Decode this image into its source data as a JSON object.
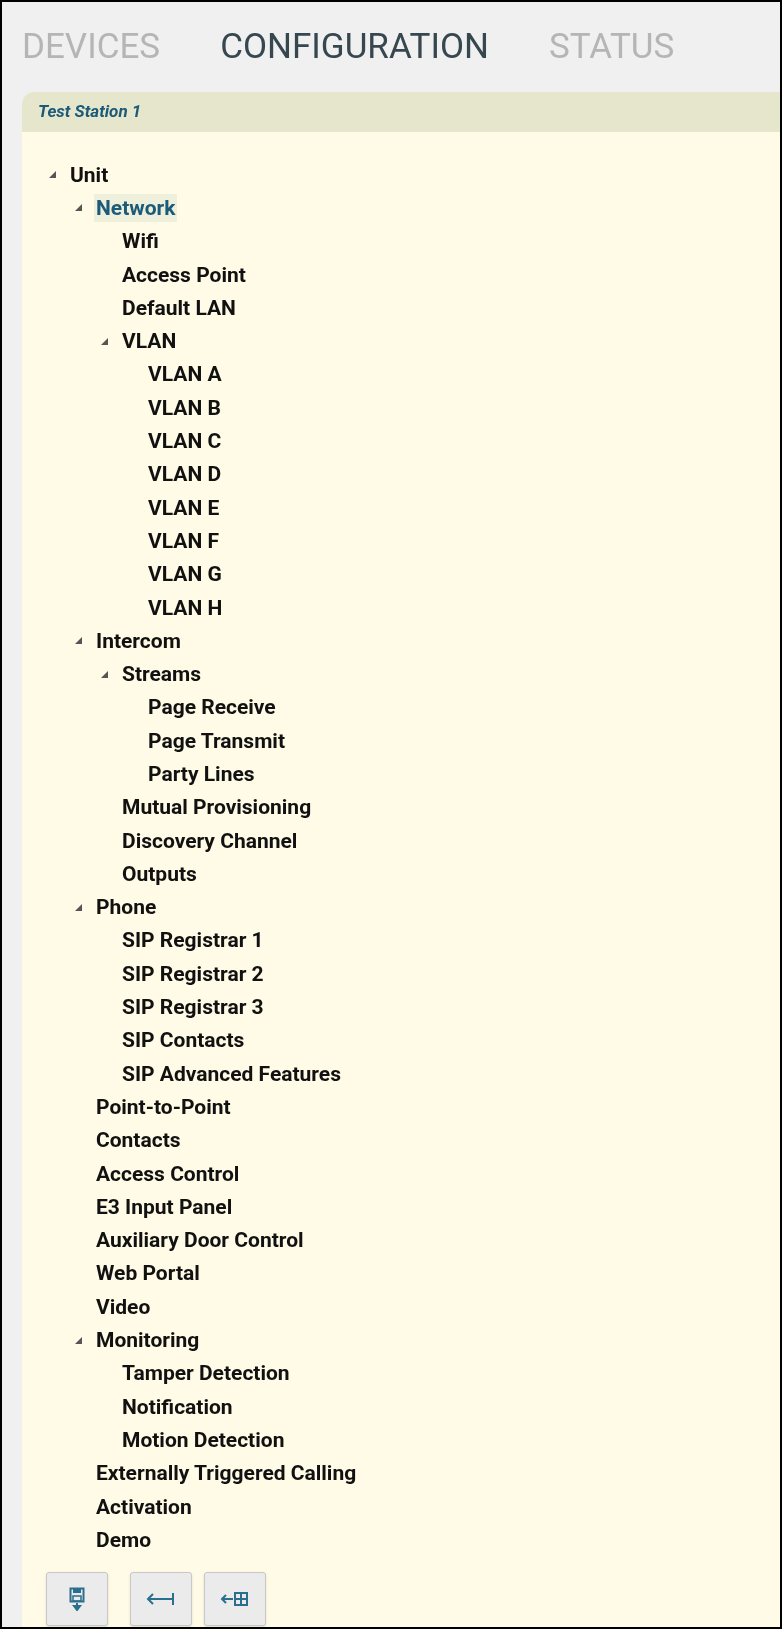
{
  "tabs": [
    {
      "label": "DEVICES",
      "selected": false
    },
    {
      "label": "CONFIGURATION",
      "selected": true
    },
    {
      "label": "STATUS",
      "selected": false
    }
  ],
  "panel": {
    "title": "Test Station 1"
  },
  "tree": [
    {
      "label": "Unit",
      "selected": false,
      "expanded": true,
      "children": [
        {
          "label": "Network",
          "selected": true,
          "expanded": true,
          "children": [
            {
              "label": "Wifi",
              "selected": false
            },
            {
              "label": "Access Point",
              "selected": false
            },
            {
              "label": "Default LAN",
              "selected": false
            },
            {
              "label": "VLAN",
              "selected": false,
              "expanded": true,
              "children": [
                {
                  "label": "VLAN A",
                  "selected": false
                },
                {
                  "label": "VLAN B",
                  "selected": false
                },
                {
                  "label": "VLAN C",
                  "selected": false
                },
                {
                  "label": "VLAN D",
                  "selected": false
                },
                {
                  "label": "VLAN E",
                  "selected": false
                },
                {
                  "label": "VLAN F",
                  "selected": false
                },
                {
                  "label": "VLAN G",
                  "selected": false
                },
                {
                  "label": "VLAN H",
                  "selected": false
                }
              ]
            }
          ]
        },
        {
          "label": "Intercom",
          "selected": false,
          "expanded": true,
          "children": [
            {
              "label": "Streams",
              "selected": false,
              "expanded": true,
              "children": [
                {
                  "label": "Page Receive",
                  "selected": false
                },
                {
                  "label": "Page Transmit",
                  "selected": false
                },
                {
                  "label": "Party Lines",
                  "selected": false
                }
              ]
            },
            {
              "label": "Mutual Provisioning",
              "selected": false
            },
            {
              "label": "Discovery Channel",
              "selected": false
            },
            {
              "label": "Outputs",
              "selected": false
            }
          ]
        },
        {
          "label": "Phone",
          "selected": false,
          "expanded": true,
          "children": [
            {
              "label": "SIP Registrar 1",
              "selected": false
            },
            {
              "label": "SIP Registrar 2",
              "selected": false
            },
            {
              "label": "SIP Registrar 3",
              "selected": false
            },
            {
              "label": "SIP Contacts",
              "selected": false
            },
            {
              "label": "SIP Advanced Features",
              "selected": false
            }
          ]
        },
        {
          "label": "Point-to-Point",
          "selected": false
        },
        {
          "label": "Contacts",
          "selected": false
        },
        {
          "label": "Access Control",
          "selected": false
        },
        {
          "label": "E3 Input Panel",
          "selected": false
        },
        {
          "label": "Auxiliary Door Control",
          "selected": false
        },
        {
          "label": "Web Portal",
          "selected": false
        },
        {
          "label": "Video",
          "selected": false
        },
        {
          "label": "Monitoring",
          "selected": false,
          "expanded": true,
          "children": [
            {
              "label": "Tamper Detection",
              "selected": false
            },
            {
              "label": "Notification",
              "selected": false
            },
            {
              "label": "Motion Detection",
              "selected": false
            }
          ]
        },
        {
          "label": "Externally Triggered Calling",
          "selected": false
        },
        {
          "label": "Activation",
          "selected": false
        },
        {
          "label": "Demo",
          "selected": false
        }
      ]
    }
  ],
  "toolbar": [
    {
      "kind": "save"
    },
    {
      "kind": "back"
    },
    {
      "kind": "back-grid"
    }
  ]
}
